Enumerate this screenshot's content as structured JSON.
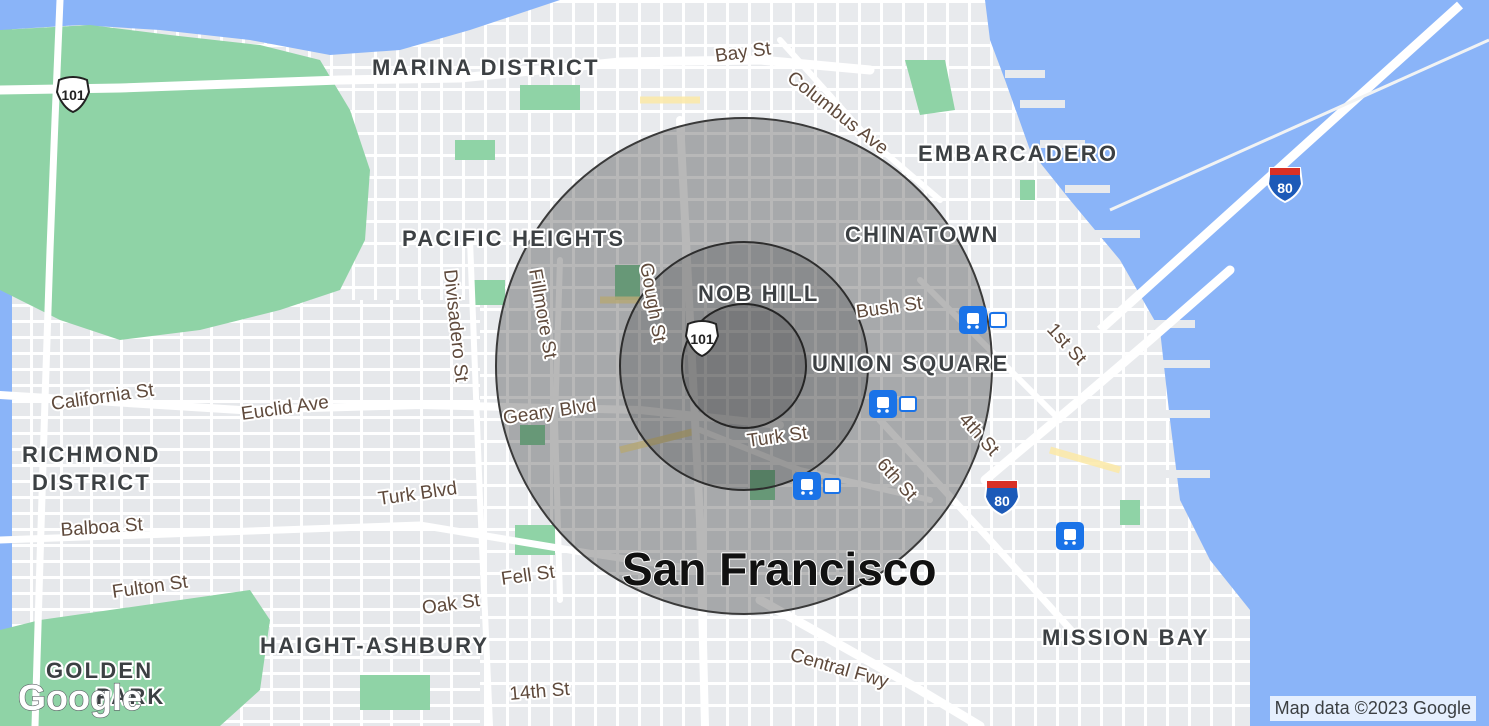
{
  "map": {
    "city_label": "San Francisco",
    "districts": [
      {
        "id": "marina-district",
        "label": "MARINA DISTRICT"
      },
      {
        "id": "embarcadero",
        "label": "EMBARCADERO"
      },
      {
        "id": "pacific-heights",
        "label": "PACIFIC HEIGHTS"
      },
      {
        "id": "chinatown",
        "label": "CHINATOWN"
      },
      {
        "id": "nob-hill",
        "label": "NOB HILL"
      },
      {
        "id": "union-square",
        "label": "UNION SQUARE"
      },
      {
        "id": "richmond-district-1",
        "label": "RICHMOND"
      },
      {
        "id": "richmond-district-2",
        "label": "DISTRICT"
      },
      {
        "id": "haight-ashbury",
        "label": "HAIGHT-ASHBURY"
      },
      {
        "id": "mission-bay",
        "label": "MISSION BAY"
      },
      {
        "id": "golden-gate",
        "label": "GOLDEN"
      },
      {
        "id": "golden-gate-2",
        "label": "PARK"
      }
    ],
    "streets": [
      {
        "id": "bay-st",
        "label": "Bay St"
      },
      {
        "id": "columbus-ave",
        "label": "Columbus Ave"
      },
      {
        "id": "fillmore-st",
        "label": "Fillmore St"
      },
      {
        "id": "gough-st",
        "label": "Gough St"
      },
      {
        "id": "divisadero-st",
        "label": "Divisadero St"
      },
      {
        "id": "bush-st",
        "label": "Bush St"
      },
      {
        "id": "1st-st",
        "label": "1st St"
      },
      {
        "id": "california-st",
        "label": "California St"
      },
      {
        "id": "euclid-ave",
        "label": "Euclid Ave"
      },
      {
        "id": "geary-blvd",
        "label": "Geary Blvd"
      },
      {
        "id": "turk-st",
        "label": "Turk St"
      },
      {
        "id": "4th-st",
        "label": "4th St"
      },
      {
        "id": "6th-st",
        "label": "6th St"
      },
      {
        "id": "turk-blvd",
        "label": "Turk Blvd"
      },
      {
        "id": "balboa-st",
        "label": "Balboa St"
      },
      {
        "id": "fulton-st",
        "label": "Fulton St"
      },
      {
        "id": "fell-st",
        "label": "Fell St"
      },
      {
        "id": "oak-st",
        "label": "Oak St"
      },
      {
        "id": "central-fwy",
        "label": "Central Fwy"
      },
      {
        "id": "14th-st",
        "label": "14th St"
      }
    ],
    "shields": [
      {
        "id": "us-101-north",
        "label": "101",
        "type": "us-highway"
      },
      {
        "id": "us-101-center",
        "label": "101",
        "type": "us-highway"
      },
      {
        "id": "i-80-bridge",
        "label": "80",
        "type": "interstate"
      },
      {
        "id": "i-80-south",
        "label": "80",
        "type": "interstate"
      }
    ],
    "transit_stops": [
      {
        "id": "transit-stop-montgomery",
        "icon": "train-icon",
        "has_bart": true
      },
      {
        "id": "transit-stop-powell",
        "icon": "train-icon",
        "has_bart": true
      },
      {
        "id": "transit-stop-civic-center",
        "icon": "train-icon",
        "has_bart": true
      },
      {
        "id": "transit-stop-caltrain",
        "icon": "train-icon",
        "has_bart": false
      }
    ],
    "radius_rings": 3,
    "colors": {
      "water": "#8ab4f8",
      "park": "#8fd3a6",
      "land": "#eef0f2",
      "road": "#ffffff",
      "arterial": "#fce9a6",
      "ring_fill": "#000000",
      "transit_blue": "#1a73e8"
    }
  },
  "branding": {
    "logo_text": "Google",
    "attribution": "Map data ©2023 Google"
  }
}
